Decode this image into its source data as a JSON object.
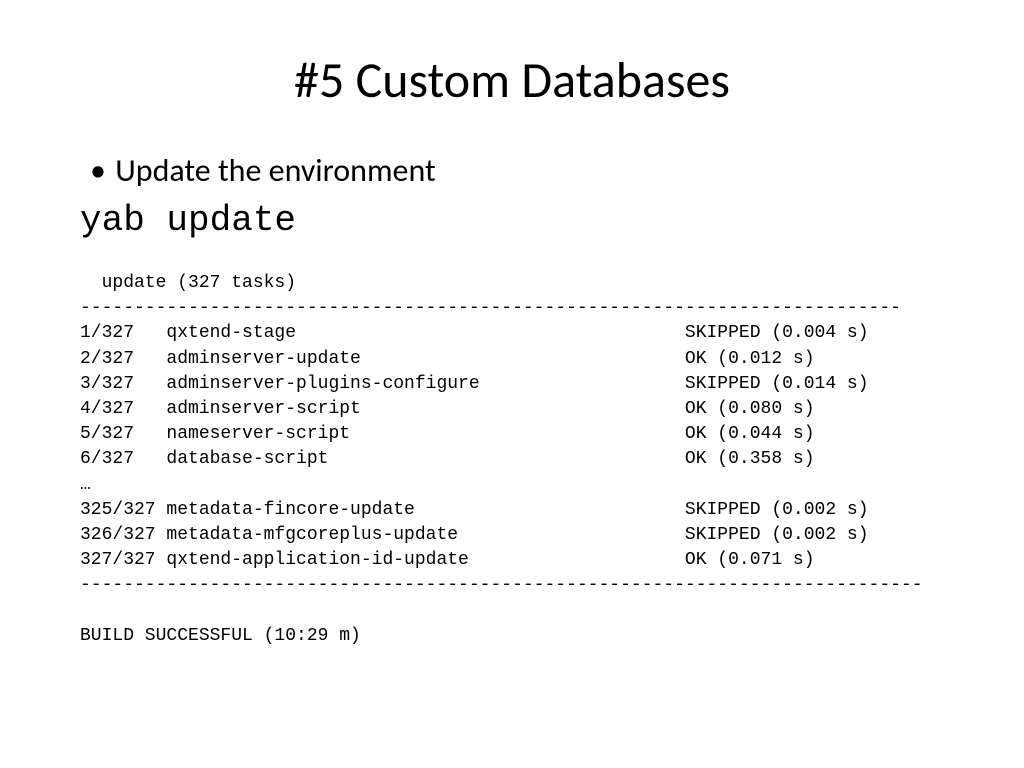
{
  "title": "#5 Custom Databases",
  "bullet": "Update the environment",
  "command": "yab update",
  "term_header": "  update (327 tasks)",
  "divider": "----------------------------------------------------------------------------",
  "tasks": [
    {
      "idx": "1/327",
      "name": "qxtend-stage",
      "status": "SKIPPED (0.004 s)"
    },
    {
      "idx": "2/327",
      "name": "adminserver-update",
      "status": "OK (0.012 s)"
    },
    {
      "idx": "3/327",
      "name": "adminserver-plugins-configure",
      "status": "SKIPPED (0.014 s)"
    },
    {
      "idx": "4/327",
      "name": "adminserver-script",
      "status": "OK (0.080 s)"
    },
    {
      "idx": "5/327",
      "name": "nameserver-script",
      "status": "OK (0.044 s)"
    },
    {
      "idx": "6/327",
      "name": "database-script",
      "status": "OK (0.358 s)"
    }
  ],
  "ellipsis": "…",
  "tasks_tail": [
    {
      "idx": "325/327",
      "name": "metadata-fincore-update",
      "status": "SKIPPED (0.002 s)"
    },
    {
      "idx": "326/327",
      "name": "metadata-mfgcoreplus-update",
      "status": "SKIPPED (0.002 s)"
    },
    {
      "idx": "327/327",
      "name": "qxtend-application-id-update",
      "status": "OK (0.071 s)"
    }
  ],
  "divider2": "------------------------------------------------------------------------------",
  "footer": "BUILD SUCCESSFUL (10:29 m)"
}
